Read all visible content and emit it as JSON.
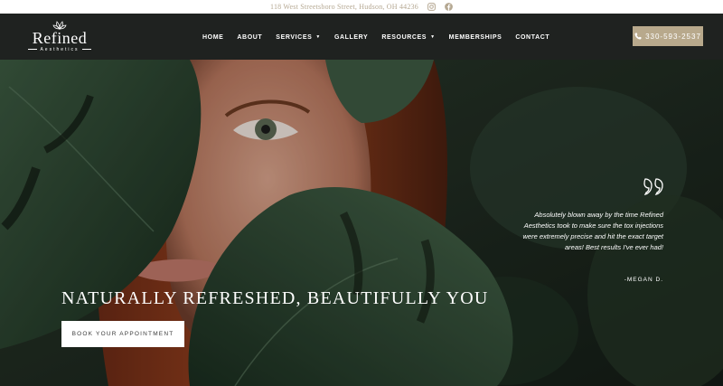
{
  "topbar": {
    "address": "118 West Streetsboro Street, Hudson, OH 44236",
    "icons": [
      "instagram-icon",
      "facebook-icon"
    ]
  },
  "brand": {
    "name": "Refined",
    "tagline": "Aesthetics"
  },
  "nav": {
    "items": [
      {
        "label": "HOME",
        "dropdown": false
      },
      {
        "label": "ABOUT",
        "dropdown": false
      },
      {
        "label": "SERVICES",
        "dropdown": true
      },
      {
        "label": "GALLERY",
        "dropdown": false
      },
      {
        "label": "RESOURCES",
        "dropdown": true
      },
      {
        "label": "MEMBERSHIPS",
        "dropdown": false
      },
      {
        "label": "CONTACT",
        "dropdown": false
      }
    ],
    "phone": "330-593-2537"
  },
  "hero": {
    "headline": "Naturally Refreshed, Beautifully You",
    "cta_label": "BOOK YOUR APPOINTMENT"
  },
  "testimonial": {
    "quote": "Absolutely blown away by the time Refined Aesthetics took to make sure the tox injections were extremely precise and hit the exact target areas! Best results I've ever had!",
    "author": "-MEGAN D."
  },
  "colors": {
    "nav_bg": "#1f2220",
    "accent": "#b8a98c",
    "address_text": "#b5a892",
    "leaf_dark": "#1f3a26"
  }
}
